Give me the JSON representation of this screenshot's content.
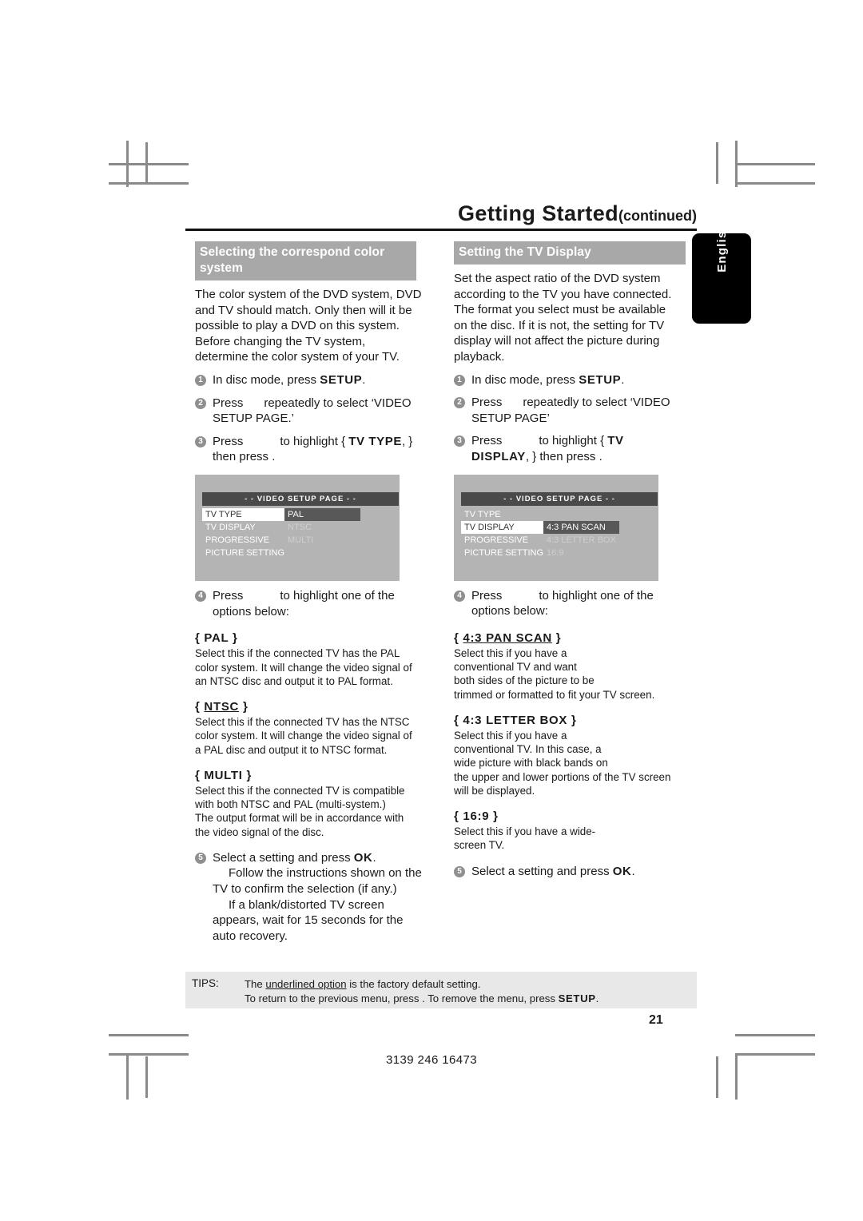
{
  "header": {
    "title": "Getting Started",
    "continued": "(continued)",
    "language_tab": "English"
  },
  "left_column": {
    "section_heading": "Selecting the correspond color system",
    "intro": "The color system of the DVD system, DVD and TV should match. Only then will it be possible to play a DVD on this system. Before changing the TV system, determine the color system of your TV.",
    "steps": [
      {
        "num": "1",
        "text_before": "In disc mode, press ",
        "bold": "SETUP",
        "text_after": "."
      },
      {
        "num": "2",
        "text_before": "Press",
        "bold": "",
        "text_after": "repeatedly to select ‘VIDEO SETUP PAGE.’"
      },
      {
        "num": "3",
        "text_before": "Press",
        "bold": "TV TYPE",
        "text_after": "to highlight {",
        "tail": ", } then press ."
      },
      {
        "num": "4",
        "text_before": "Press",
        "bold": "",
        "text_after": "to highlight one of the options below:"
      },
      {
        "num": "5",
        "text_before": "Select a setting and press ",
        "bold": "OK",
        "text_after": "."
      }
    ],
    "step5_extra_1": "Follow the instructions shown on the TV to confirm the selection (if any.)",
    "step5_extra_2": "If a blank/distorted TV screen appears, wait for 15 seconds for the auto recovery.",
    "osd": {
      "bar_title": "- -  VIDEO  SETUP  PAGE  - -",
      "rows": [
        {
          "name": "TV TYPE",
          "selected": true,
          "value": "PAL",
          "value_highlighted": true
        },
        {
          "name": "TV DISPLAY",
          "selected": false,
          "value": "NTSC",
          "value_highlighted": false
        },
        {
          "name": "PROGRESSIVE",
          "selected": false,
          "value": "MULTI",
          "value_highlighted": false
        },
        {
          "name": "PICTURE SETTING",
          "selected": false,
          "value": "",
          "value_highlighted": false
        }
      ]
    },
    "options": [
      {
        "open": "{",
        "name": "PAL",
        "close": "}",
        "underlined": false,
        "lines": [
          "Select this if the connected TV has the PAL",
          "color system. It will change the video signal of",
          "an NTSC disc and output it to PAL format."
        ]
      },
      {
        "open": "{",
        "name": "NTSC",
        "close": "}",
        "underlined": true,
        "lines": [
          "Select this if the connected TV has the NTSC",
          "color system. It will change the video signal of",
          "a PAL disc and output it to NTSC format."
        ]
      },
      {
        "open": "{",
        "name": "MULTI",
        "close": "}",
        "underlined": false,
        "lines": [
          "Select this if the connected TV is compatible",
          "with both NTSC and PAL (multi-system.)",
          "The output format will be in accordance with",
          "the video signal of the disc."
        ]
      }
    ]
  },
  "right_column": {
    "section_heading": "Setting the TV Display",
    "intro": "Set the aspect ratio of the DVD system according to the TV you have connected. The format you select must be available on the disc. If it is not, the setting for TV display will not affect the picture during playback.",
    "steps": [
      {
        "num": "1",
        "text_before": "In disc mode, press ",
        "bold": "SETUP",
        "text_after": "."
      },
      {
        "num": "2",
        "text_before": "Press",
        "bold": "",
        "text_after": "repeatedly to select ‘VIDEO SETUP PAGE’"
      },
      {
        "num": "3",
        "text_before": "Press",
        "bold": "TV DISPLAY",
        "text_after": "to highlight {",
        "tail": ", } then press ."
      },
      {
        "num": "4",
        "text_before": "Press",
        "bold": "",
        "text_after": "to highlight one of the options below:"
      },
      {
        "num": "5",
        "text_before": "Select a setting and press ",
        "bold": "OK",
        "text_after": "."
      }
    ],
    "osd": {
      "bar_title": "- -  VIDEO  SETUP  PAGE  - -",
      "rows": [
        {
          "name": "TV TYPE",
          "selected": false,
          "value": "",
          "value_highlighted": false
        },
        {
          "name": "TV DISPLAY",
          "selected": true,
          "value": "4:3 PAN SCAN",
          "value_highlighted": true
        },
        {
          "name": "PROGRESSIVE",
          "selected": false,
          "value": "4:3 LETTER BOX",
          "value_highlighted": false
        },
        {
          "name": "PICTURE SETTING",
          "selected": false,
          "value": "16:9",
          "value_highlighted": false
        }
      ]
    },
    "options": [
      {
        "open": "{",
        "name": "4:3 PAN SCAN",
        "close": "}",
        "underlined": true,
        "lines": [
          "Select this if you have a",
          "conventional TV and want",
          "both sides of the picture to be",
          "trimmed or formatted to fit your TV screen."
        ]
      },
      {
        "open": "{",
        "name": "4:3 LETTER BOX",
        "close": "}",
        "underlined": false,
        "lines": [
          "Select this if you have a",
          "conventional TV. In this case, a",
          "wide picture with black bands on",
          "the upper and lower portions of the TV screen",
          "will be displayed."
        ]
      },
      {
        "open": "{",
        "name": "16:9",
        "close": "}",
        "underlined": false,
        "lines": [
          "Select this if you have a wide-",
          "screen TV."
        ]
      }
    ]
  },
  "tips": {
    "label": "TIPS:",
    "line1_a": "The ",
    "line1_u": "underlined option",
    "line1_b": " is the factory default setting.",
    "line2_a": "To return to the previous menu, press    . To remove the menu, press ",
    "line2_bold": "SETUP",
    "line2_b": "."
  },
  "footer": {
    "page_number": "21",
    "document_code": "3139 246 16473"
  },
  "colors": {
    "section_heading_bg": "#a8a8a8",
    "osd_bg": "#b4b4b4",
    "osd_bar_bg": "#4a4a4a",
    "osd_highlight_bg": "#585858",
    "tips_bg": "#e8e8e8",
    "bullet_bg": "#8f8f8f"
  }
}
